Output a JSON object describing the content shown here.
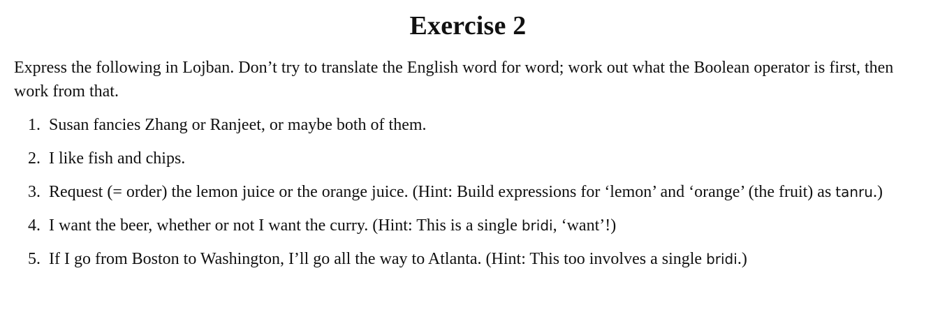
{
  "heading": "Exercise 2",
  "intro": "Express the following in Lojban. Don’t try to translate the English word for word; work out what the Boolean operator is first, then work from that.",
  "items": [
    {
      "number": "1.",
      "text_before": "Susan fancies Zhang or Ranjeet, or maybe both of them.",
      "term": "",
      "text_after": ""
    },
    {
      "number": "2.",
      "text_before": "I like fish and chips.",
      "term": "",
      "text_after": ""
    },
    {
      "number": "3.",
      "text_before": "Request (= order) the lemon juice or the orange juice. (Hint: Build expressions for ‘lemon’ and ‘orange’ (the fruit) as ",
      "term": "tanru",
      "text_after": ".)"
    },
    {
      "number": "4.",
      "text_before": "I want the beer, whether or not I want the curry. (Hint: This is a single ",
      "term": "bridi",
      "text_after": ", ‘want’!)"
    },
    {
      "number": "5.",
      "text_before": "If I go from Boston to Washington, I’ll go all the way to Atlanta. (Hint: This too involves a single ",
      "term": "bridi",
      "text_after": ".)"
    }
  ]
}
